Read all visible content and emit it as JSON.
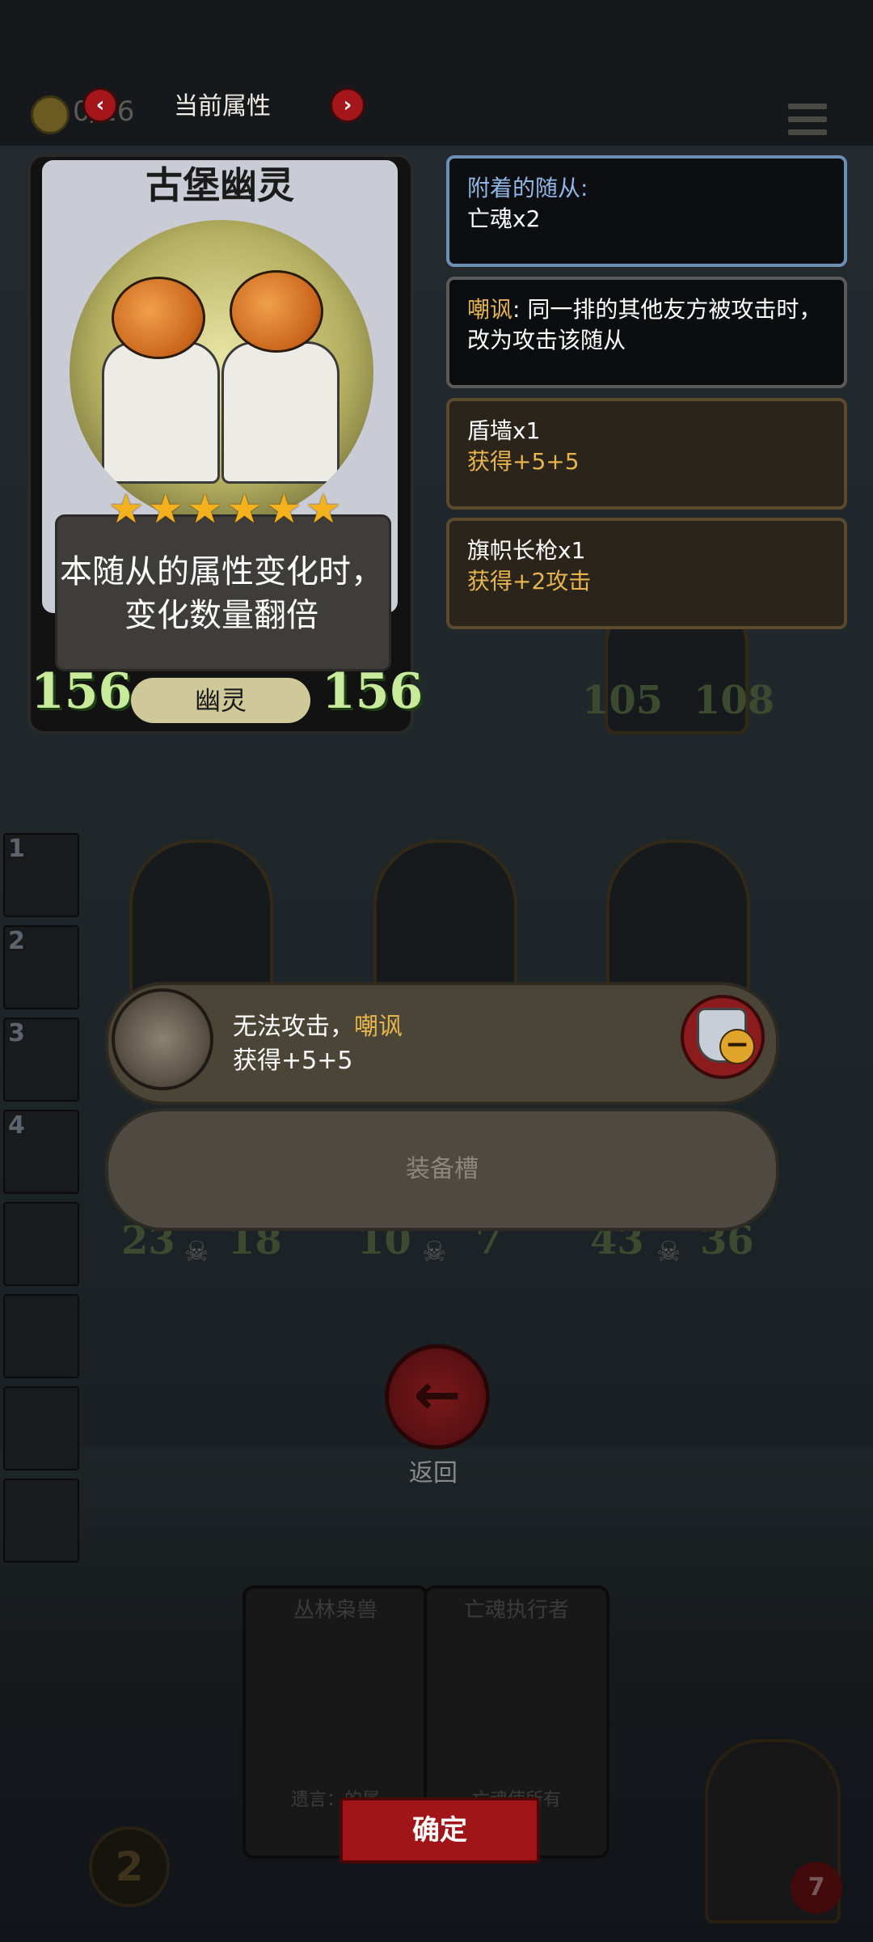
{
  "header": {
    "coin_count": "0/16",
    "title": "当前属性",
    "prev_label": "‹",
    "next_label": "›"
  },
  "card": {
    "name": "古堡幽灵",
    "stars": "★★★★★★",
    "star_count": 6,
    "description": "本随从的属性变化时，变化数量翻倍",
    "attack": "156",
    "health": "156",
    "type": "幽灵"
  },
  "panels": [
    {
      "title": "附着的随从:",
      "body": "亡魂x2"
    },
    {
      "title": "嘲讽",
      "body": ": 同一排的其他友方被攻击时，改为攻击该随从"
    },
    {
      "title": "盾墙x1",
      "body": "获得+5+5"
    },
    {
      "title": "旗帜长枪x1",
      "body": "获得+2攻击"
    }
  ],
  "board": {
    "top_minion": {
      "attack": "105",
      "health": "108"
    },
    "minions": [
      {
        "attack": "23",
        "health": "18"
      },
      {
        "attack": "10",
        "health": "7"
      },
      {
        "attack": "43",
        "health": "36"
      }
    ]
  },
  "queue": [
    "1",
    "2",
    "3",
    "4",
    "",
    "",
    "",
    ""
  ],
  "ability": {
    "line1_prefix": "无法攻击，",
    "line1_keyword": "嘲讽",
    "line2": "获得+5+5"
  },
  "slot_label": "装备槽",
  "return_label": "返回",
  "bottom": {
    "card_left_name": "丛林枭兽",
    "card_right_name": "亡魂执行者",
    "card_left_text": "遗言：的属",
    "card_right_text": "亡魂使所有",
    "confirm_label": "确定",
    "level": "2",
    "hero_health": "7"
  },
  "colors": {
    "accent_red": "#a11519",
    "star_gold": "#f4b11e",
    "stat_green": "#c8eb9b",
    "keyword_gold": "#e6b54e",
    "panel_blue": "#8fb6e4"
  }
}
